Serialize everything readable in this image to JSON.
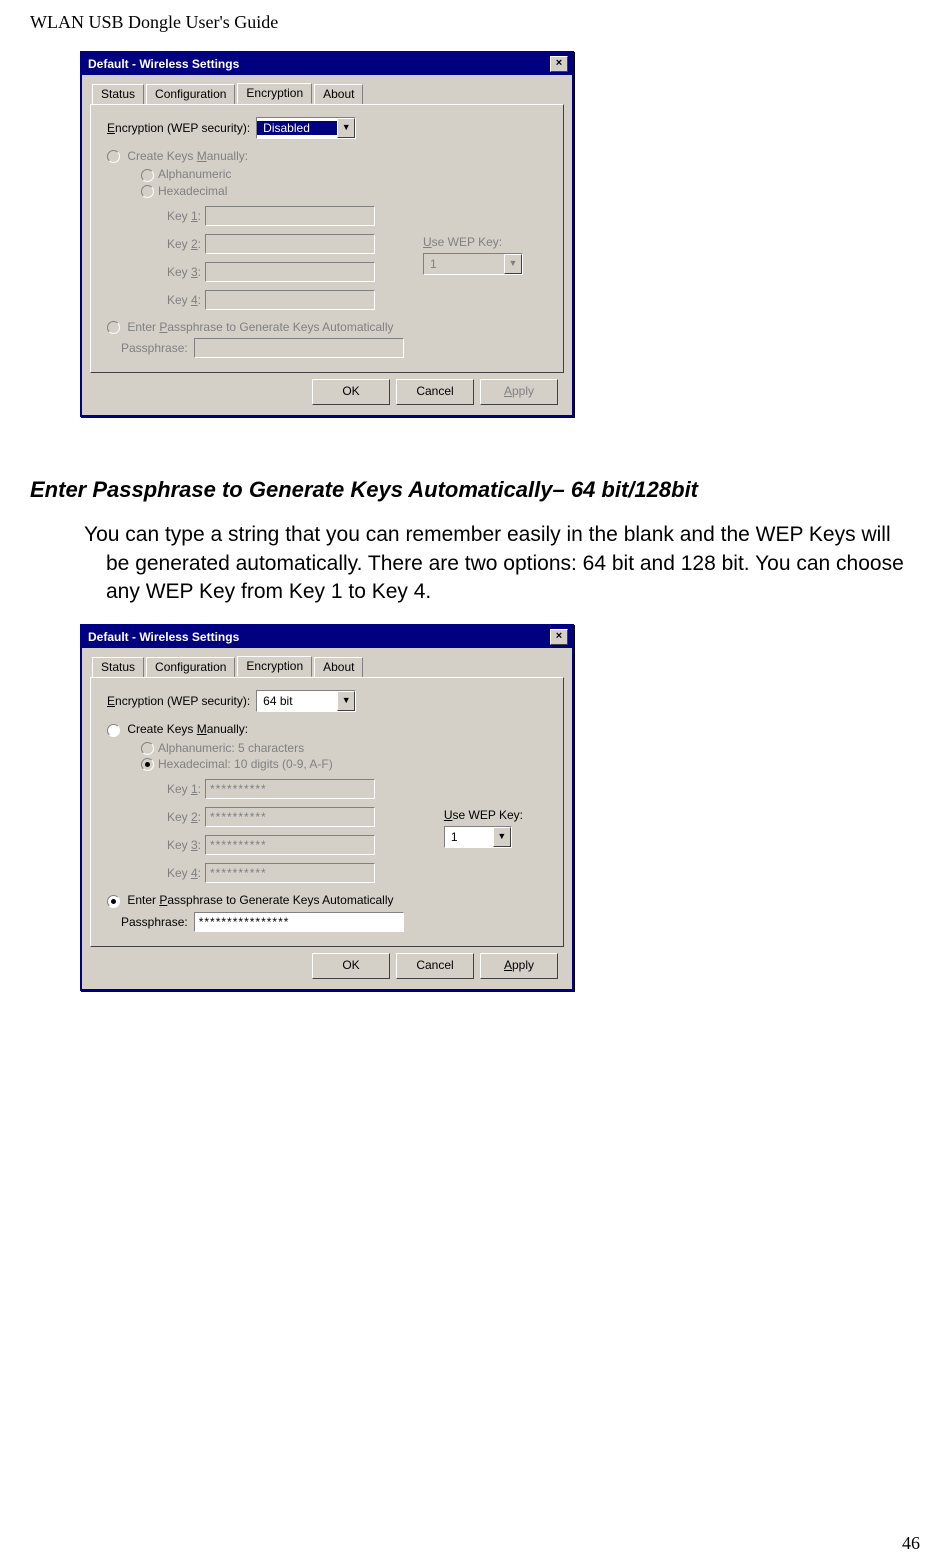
{
  "header": "WLAN USB Dongle User's Guide",
  "dlg1": {
    "title": "Default - Wireless Settings",
    "tabs": [
      "Status",
      "Configuration",
      "Encryption",
      "About"
    ],
    "enc_label_pre": "E",
    "enc_label_rest": "ncryption (WEP security):",
    "enc_value": "Disabled",
    "manual_pre": "Create Keys ",
    "manual_u": "M",
    "manual_rest": "anually:",
    "alpha": "Alphanumeric",
    "hex": "Hexadecimal",
    "key_u": [
      "1",
      "2",
      "3",
      "4"
    ],
    "key_lbl": "Key ",
    "colon": ":",
    "use_pre": "U",
    "use_rest": "se WEP Key:",
    "use_val": "1",
    "auto_pre": "Enter ",
    "auto_u": "P",
    "auto_rest": "assphrase to Generate Keys Automatically",
    "pass_lbl": "Passphrase:",
    "ok": "OK",
    "cancel": "Cancel",
    "apply_u": "A",
    "apply_rest": "pply"
  },
  "section_title": "Enter Passphrase to Generate Keys Automatically– 64 bit/128bit",
  "body_text": "You can type a string that you can remember easily in the blank and the WEP Keys will be generated automatically. There are two options: 64 bit and 128 bit. You can choose any WEP Key from Key 1 to Key 4.",
  "dlg2": {
    "title": "Default - Wireless Settings",
    "enc_value": "64 bit",
    "alpha": "Alphanumeric: 5 characters",
    "hex": "Hexadecimal: 10 digits (0-9, A-F)",
    "key_vals": [
      "**********",
      "**********",
      "**********",
      "**********"
    ],
    "use_val": "1",
    "pass_val": "****************"
  },
  "page_number": "46"
}
